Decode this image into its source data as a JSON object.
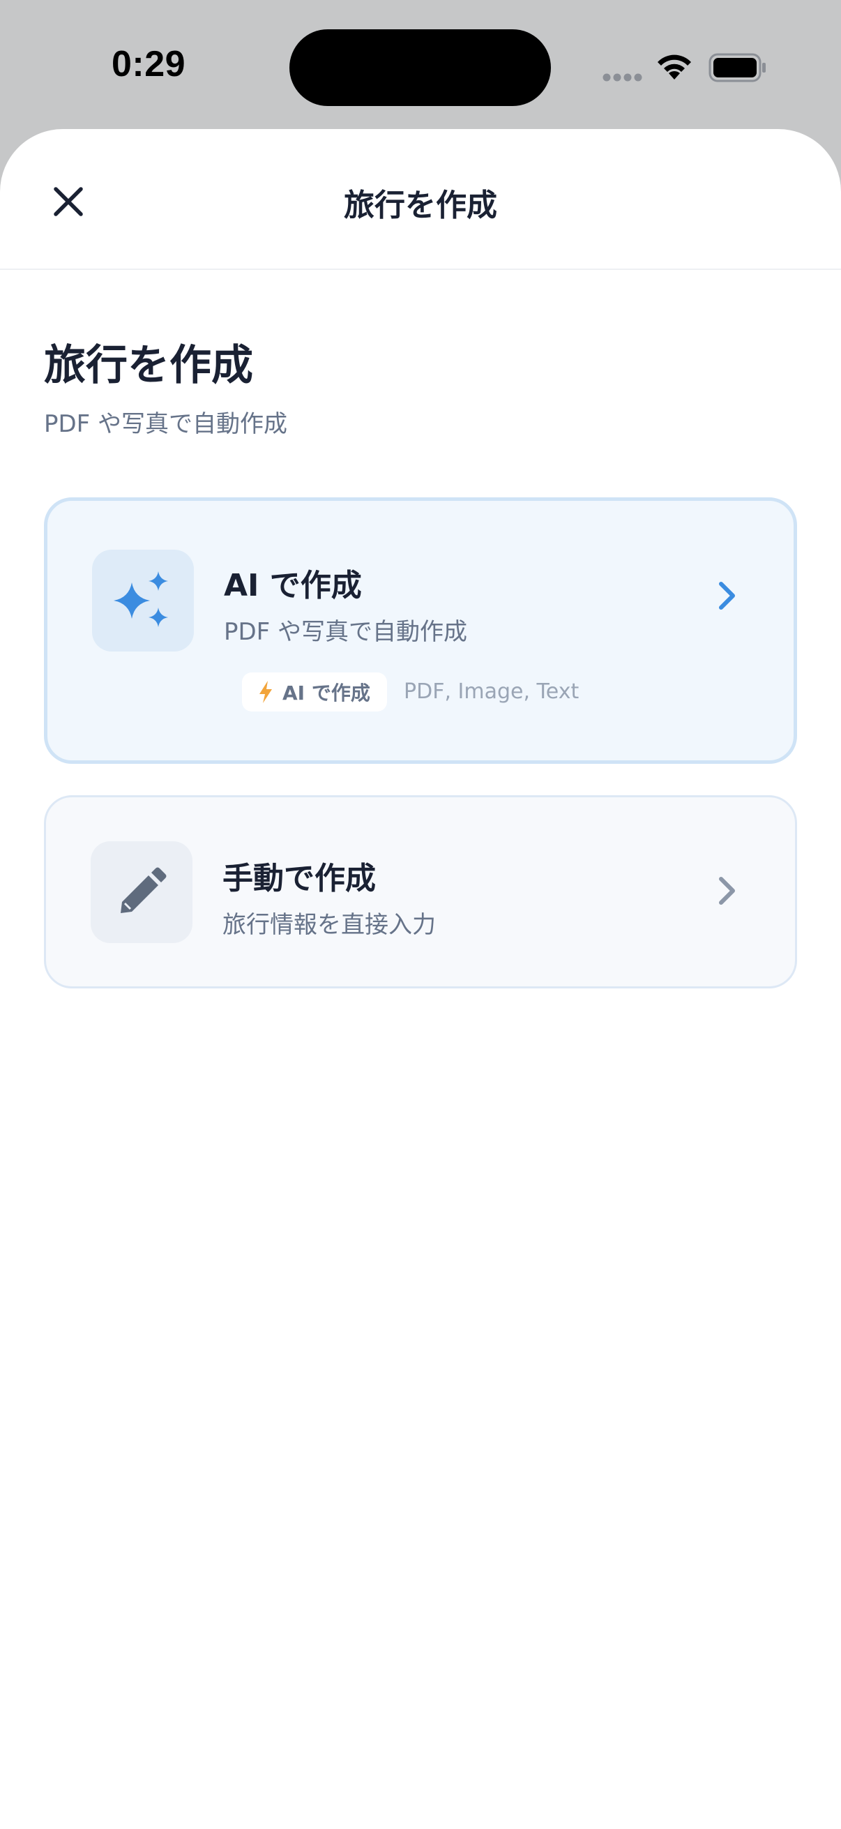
{
  "status_bar": {
    "time": "0:29"
  },
  "header": {
    "title": "旅行を作成",
    "close_icon": "close-icon"
  },
  "page": {
    "title": "旅行を作成",
    "subtitle": "PDF や写真で自動作成"
  },
  "cards": {
    "ai": {
      "title": "AI で作成",
      "description": "PDF や写真で自動作成",
      "icon": "sparkles-icon",
      "tag_label": "AI で作成",
      "tag_icon": "lightning-icon",
      "formats": "PDF, Image, Text",
      "accent_color": "#3b8ce0"
    },
    "manual": {
      "title": "手動で作成",
      "description": "旅行情報を直接入力",
      "icon": "pencil-icon",
      "accent_color": "#8c97a8"
    }
  },
  "colors": {
    "accent": "#3b8ce0",
    "title_text": "#1a2133",
    "secondary_text": "#667389",
    "lightning": "#f2a43a"
  }
}
